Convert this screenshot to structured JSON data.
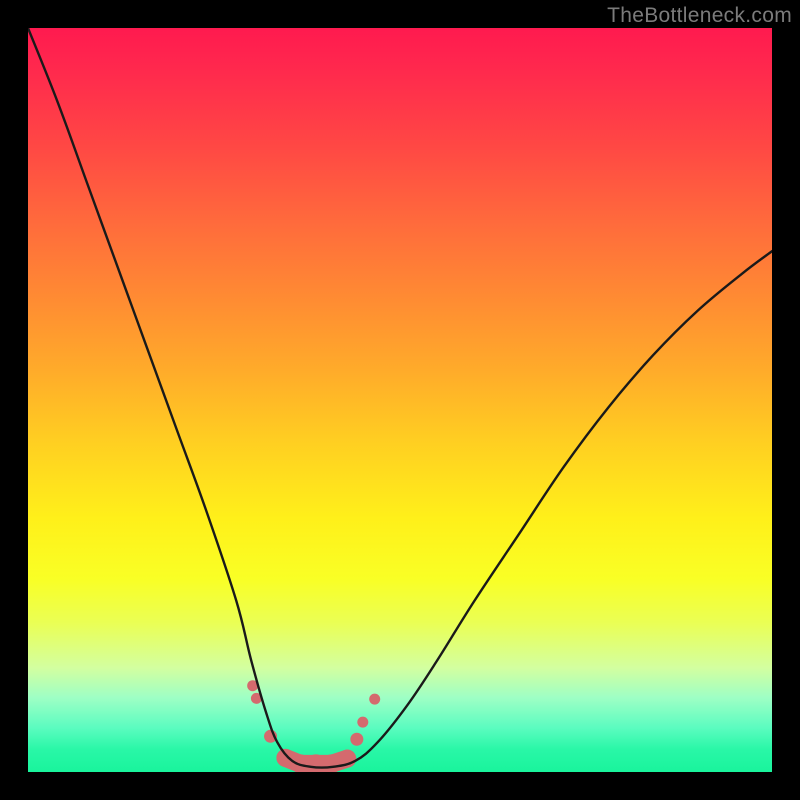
{
  "watermark": "TheBottleneck.com",
  "colors": {
    "frame": "#000000",
    "curve_stroke": "#1a1a1a",
    "marker_fill": "#d46a6e",
    "marker_stroke": "#c95a5e",
    "gradient_top": "#ff1a4f",
    "gradient_bottom": "#19f49c"
  },
  "chart_data": {
    "type": "line",
    "title": "",
    "xlabel": "",
    "ylabel": "",
    "xlim": [
      0,
      100
    ],
    "ylim": [
      0,
      100
    ],
    "grid": false,
    "legend": false,
    "note": "Bottleneck-style V-curve over vertical rainbow gradient. Axes are unlabeled; x treated as 0–100 horizontal position, y as 0 (bottom) to 100 (top). Values are visual estimates.",
    "series": [
      {
        "name": "curve",
        "x": [
          0,
          4,
          8,
          12,
          16,
          20,
          24,
          28,
          30,
          32,
          33.5,
          35.5,
          38,
          41,
          44,
          47,
          51,
          55,
          60,
          66,
          72,
          78,
          84,
          90,
          96,
          100
        ],
        "y": [
          100,
          90,
          79,
          68,
          57,
          46,
          35,
          23,
          15,
          8,
          4,
          1.5,
          0.7,
          0.7,
          1.5,
          4,
          9,
          15,
          23,
          32,
          41,
          49,
          56,
          62,
          67,
          70
        ]
      }
    ],
    "markers": {
      "name": "dots",
      "note": "Salmon sausage/dots near valley floor",
      "x": [
        30.2,
        30.7,
        32.6,
        34.6,
        36.6,
        38.7,
        40.8,
        42.9,
        44.2,
        45.0,
        46.6
      ],
      "y": [
        11.6,
        9.9,
        4.8,
        1.9,
        1.1,
        1.1,
        1.1,
        1.8,
        4.4,
        6.7,
        9.8
      ],
      "r": [
        5.5,
        5.5,
        6.5,
        9.0,
        9.5,
        9.5,
        9.5,
        9.0,
        6.5,
        5.5,
        5.5
      ]
    }
  }
}
